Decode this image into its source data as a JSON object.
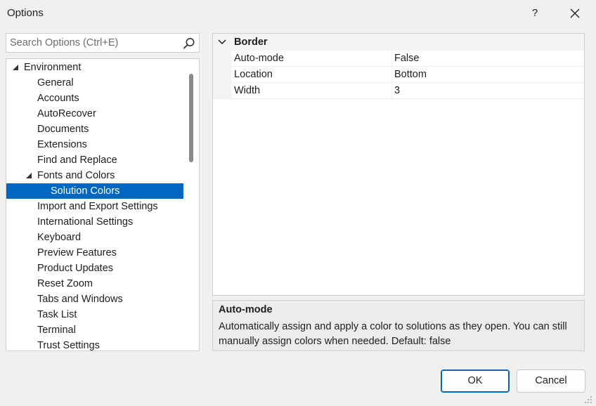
{
  "window": {
    "title": "Options",
    "help_label": "?"
  },
  "search": {
    "placeholder": "Search Options (Ctrl+E)",
    "value": ""
  },
  "tree": {
    "items": [
      {
        "label": "Environment"
      },
      {
        "label": "General"
      },
      {
        "label": "Accounts"
      },
      {
        "label": "AutoRecover"
      },
      {
        "label": "Documents"
      },
      {
        "label": "Extensions"
      },
      {
        "label": "Find and Replace"
      },
      {
        "label": "Fonts and Colors"
      },
      {
        "label": "Solution Colors"
      },
      {
        "label": "Import and Export Settings"
      },
      {
        "label": "International Settings"
      },
      {
        "label": "Keyboard"
      },
      {
        "label": "Preview Features"
      },
      {
        "label": "Product Updates"
      },
      {
        "label": "Reset Zoom"
      },
      {
        "label": "Tabs and Windows"
      },
      {
        "label": "Task List"
      },
      {
        "label": "Terminal"
      },
      {
        "label": "Trust Settings"
      }
    ],
    "selected": "Solution Colors"
  },
  "grid": {
    "category": "Border",
    "properties": [
      {
        "name": "Auto-mode",
        "value": "False"
      },
      {
        "name": "Location",
        "value": "Bottom"
      },
      {
        "name": "Width",
        "value": "3"
      }
    ]
  },
  "description": {
    "title": "Auto-mode",
    "text": "Automatically assign and apply a color to solutions as they open. You can still manually assign colors when needed. Default: false"
  },
  "buttons": {
    "ok": "OK",
    "cancel": "Cancel"
  },
  "icons": {
    "search": "search-icon",
    "close": "close-icon",
    "expand": "expanded-arrow-icon",
    "chevron": "chevron-down-icon"
  },
  "colors": {
    "selection": "#0067c0",
    "background": "#f0f0f0"
  }
}
